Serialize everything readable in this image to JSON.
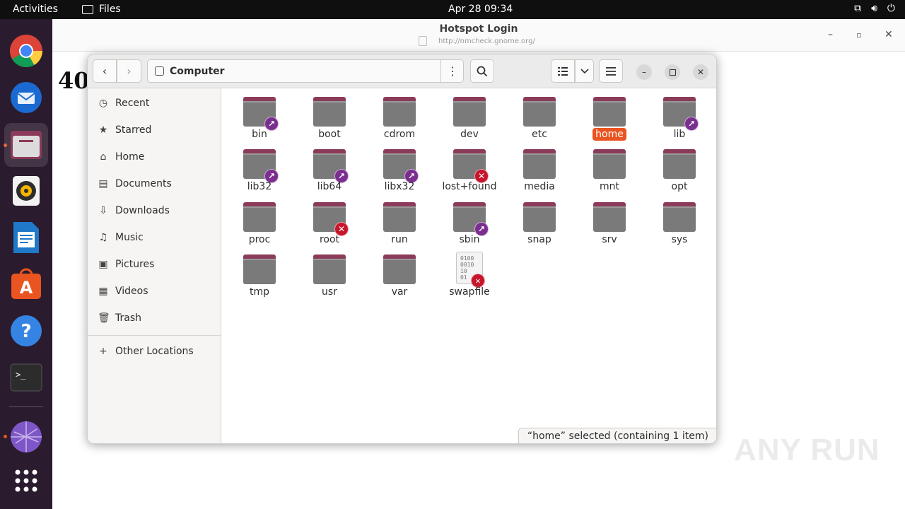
{
  "topbar": {
    "activities": "Activities",
    "app_name": "Files",
    "clock": "Apr 28  09:34"
  },
  "dock": {
    "items": [
      "chrome",
      "thunderbird",
      "files",
      "rhythmbox",
      "libreoffice-writer",
      "ubuntu-software",
      "help",
      "terminal",
      "network"
    ],
    "accent": "#e95420"
  },
  "browser": {
    "title": "Hotspot Login",
    "url": "http://nmcheck.gnome.org/",
    "heading": "40"
  },
  "files": {
    "location": "Computer",
    "sidebar": [
      {
        "label": "Recent",
        "icon": "clock-icon"
      },
      {
        "label": "Starred",
        "icon": "star-icon"
      },
      {
        "label": "Home",
        "icon": "home-icon"
      },
      {
        "label": "Documents",
        "icon": "document-icon"
      },
      {
        "label": "Downloads",
        "icon": "download-icon"
      },
      {
        "label": "Music",
        "icon": "music-icon"
      },
      {
        "label": "Pictures",
        "icon": "pictures-icon"
      },
      {
        "label": "Videos",
        "icon": "videos-icon"
      },
      {
        "label": "Trash",
        "icon": "trash-icon"
      }
    ],
    "other_locations": "Other Locations",
    "items": [
      {
        "name": "bin",
        "emblem": "link"
      },
      {
        "name": "boot",
        "emblem": ""
      },
      {
        "name": "cdrom",
        "emblem": ""
      },
      {
        "name": "dev",
        "emblem": ""
      },
      {
        "name": "etc",
        "emblem": ""
      },
      {
        "name": "home",
        "emblem": "",
        "selected": true
      },
      {
        "name": "lib",
        "emblem": "link"
      },
      {
        "name": "lib32",
        "emblem": "link"
      },
      {
        "name": "lib64",
        "emblem": "link"
      },
      {
        "name": "libx32",
        "emblem": "link"
      },
      {
        "name": "lost+found",
        "emblem": "noaccess"
      },
      {
        "name": "media",
        "emblem": ""
      },
      {
        "name": "mnt",
        "emblem": ""
      },
      {
        "name": "opt",
        "emblem": ""
      },
      {
        "name": "proc",
        "emblem": ""
      },
      {
        "name": "root",
        "emblem": "noaccess"
      },
      {
        "name": "run",
        "emblem": ""
      },
      {
        "name": "sbin",
        "emblem": "link"
      },
      {
        "name": "snap",
        "emblem": ""
      },
      {
        "name": "srv",
        "emblem": ""
      },
      {
        "name": "sys",
        "emblem": ""
      },
      {
        "name": "tmp",
        "emblem": ""
      },
      {
        "name": "usr",
        "emblem": ""
      },
      {
        "name": "var",
        "emblem": ""
      },
      {
        "name": "swapfile",
        "emblem": "noaccess",
        "type": "file"
      }
    ],
    "status": "“home” selected  (containing 1 item)"
  },
  "watermark": "ANY RUN"
}
